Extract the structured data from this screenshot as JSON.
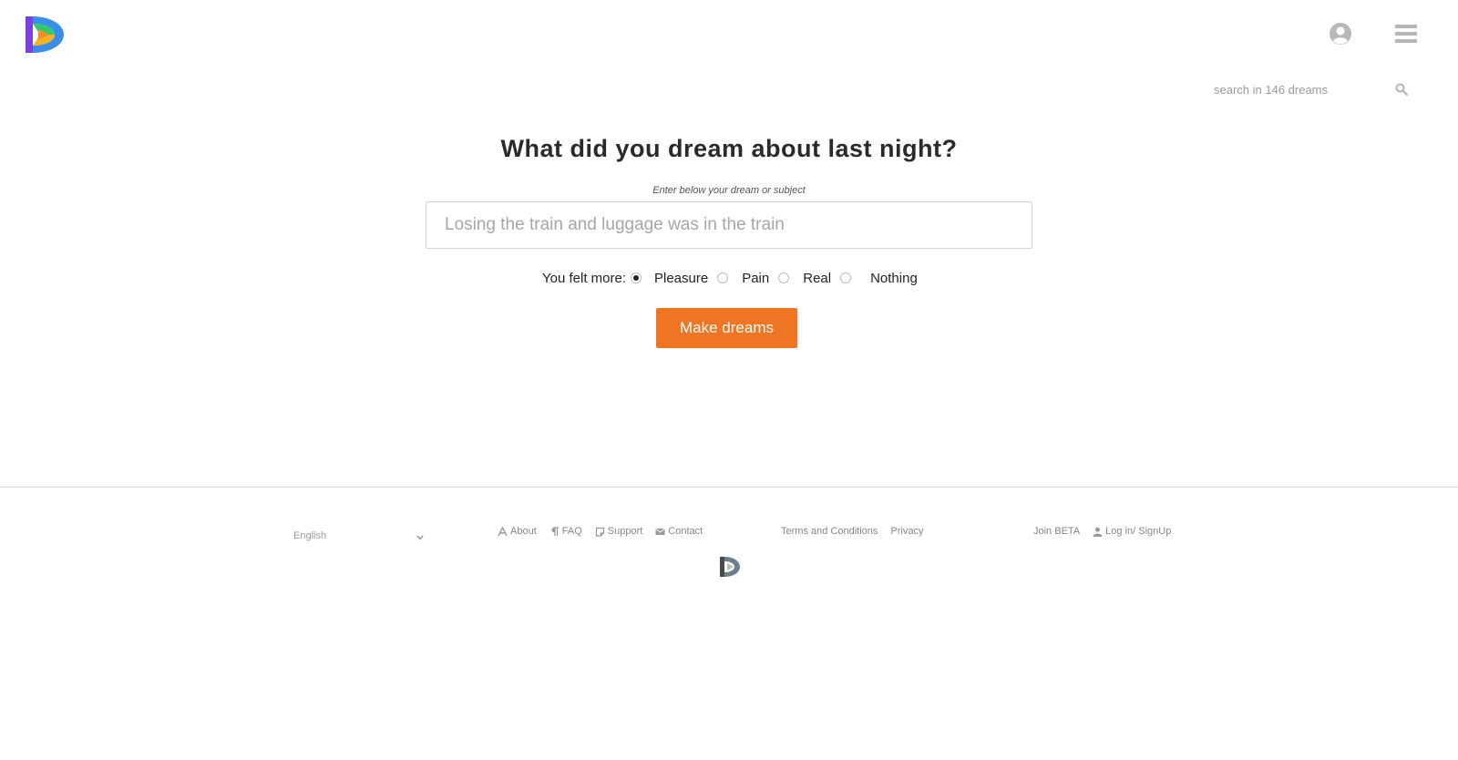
{
  "header": {
    "logo_icon": "dreamapp-logo-icon",
    "user_icon": "user-circle-icon",
    "menu_icon": "hamburger-menu-icon"
  },
  "search": {
    "placeholder": "search in 146 dreams",
    "icon": "search-icon"
  },
  "main": {
    "heading": "What did you dream about last night?",
    "hint": "Enter below your dream or subject",
    "dream_placeholder": "Losing the train and luggage was in the train",
    "mood_label": "You felt more:",
    "mood_options": [
      {
        "label": "Pleasure",
        "checked": true
      },
      {
        "label": "Pain",
        "checked": false
      },
      {
        "label": "Real",
        "checked": false
      },
      {
        "label": "Nothing",
        "checked": false
      }
    ],
    "submit_label": "Make dreams",
    "accent_color": "#f07522"
  },
  "footer": {
    "language": "English",
    "links": [
      {
        "label": "About",
        "icon": "font-a-icon"
      },
      {
        "label": "FAQ",
        "icon": "paragraph-icon"
      },
      {
        "label": "Support",
        "icon": "note-icon"
      },
      {
        "label": "Contact",
        "icon": "envelope-icon"
      }
    ],
    "legal": [
      {
        "label": "Terms and Conditions"
      },
      {
        "label": "Privacy"
      }
    ],
    "account": [
      {
        "label": "Join BETA"
      },
      {
        "label": "Log in/ SignUp",
        "icon": "user-icon"
      }
    ],
    "footer_logo_icon": "dreamapp-logo-small-icon"
  }
}
